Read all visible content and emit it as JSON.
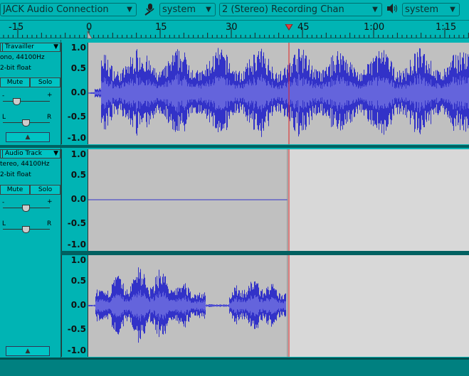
{
  "toolbar": {
    "host": "JACK Audio Connection",
    "mic_icon": "microphone-icon",
    "recording_device": "system",
    "channels": "2 (Stereo) Recording Chan",
    "speaker_icon": "speaker-icon",
    "playback_device": "system"
  },
  "ruler": {
    "labels": [
      "-15",
      "0",
      "15",
      "30",
      "45",
      "1:00",
      "1:15"
    ],
    "play_head_color": "#e02020"
  },
  "tracks": [
    {
      "name": "Travailler",
      "info_format": "ono, 44100Hz",
      "info_bits": "2-bit float",
      "mute": "Mute",
      "solo": "Solo",
      "gain_minus": "-",
      "gain_plus": "+",
      "pan_left": "L",
      "pan_right": "R",
      "collapse": "▲",
      "scale": [
        "1.0",
        "0.5",
        "0.0",
        "-0.5",
        "-1.0"
      ]
    },
    {
      "name": "Audio Track",
      "info_format": "tereo, 44100Hz",
      "info_bits": "2-bit float",
      "mute": "Mute",
      "solo": "Solo",
      "gain_minus": "-",
      "gain_plus": "+",
      "pan_left": "L",
      "pan_right": "R",
      "collapse": "▲",
      "scale_top": [
        "1.0",
        "0.5",
        "0.0",
        "-0.5",
        "-1.0"
      ],
      "scale_bottom": [
        "1.0",
        "0.5",
        "0.0",
        "-0.5",
        "-1.0"
      ]
    }
  ],
  "colors": {
    "background": "#00b4b4",
    "waveform": "#3232c8",
    "waveform_rms": "#6464dc",
    "selected_bg": "#c0c0c0",
    "unselected_bg": "#d8d8d8",
    "cursor": "#e02020"
  }
}
